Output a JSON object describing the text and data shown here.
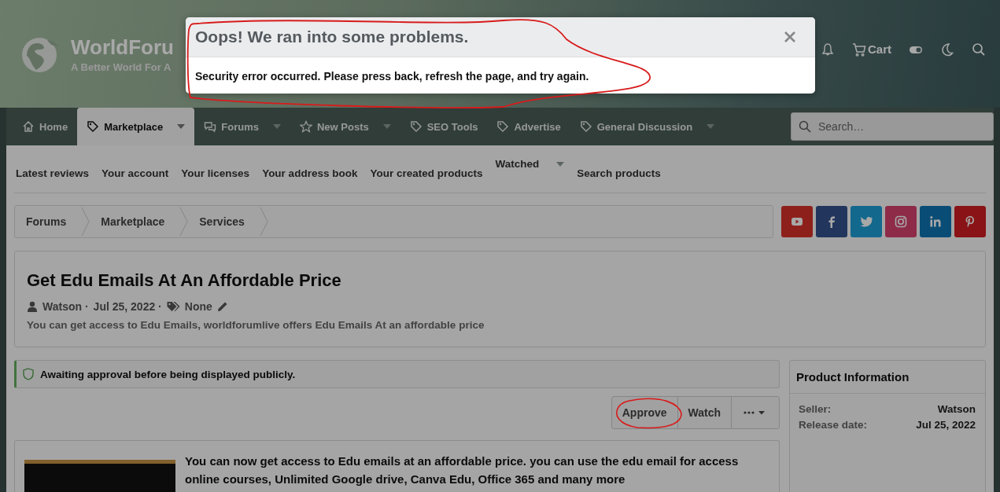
{
  "header": {
    "site_name": "WorldForu",
    "tagline": "A Better World For A",
    "cart_label": "Cart"
  },
  "nav": {
    "tabs": [
      {
        "label": "Home",
        "kind": "home",
        "dropdown": false,
        "selected": false
      },
      {
        "label": "Marketplace",
        "kind": "tag",
        "dropdown": true,
        "selected": true
      },
      {
        "label": "Forums",
        "kind": "forums",
        "dropdown": true,
        "selected": false
      },
      {
        "label": "New Posts",
        "kind": "star",
        "dropdown": true,
        "selected": false
      },
      {
        "label": "SEO Tools",
        "kind": "tag",
        "dropdown": false,
        "selected": false
      },
      {
        "label": "Advertise",
        "kind": "tag",
        "dropdown": false,
        "selected": false
      },
      {
        "label": "General Discussion",
        "kind": "tag",
        "dropdown": true,
        "selected": false
      }
    ],
    "search": {
      "placeholder": "Search…"
    }
  },
  "subnav": [
    {
      "label": "Latest reviews",
      "dropdown": false
    },
    {
      "label": "Your account",
      "dropdown": false
    },
    {
      "label": "Your licenses",
      "dropdown": false
    },
    {
      "label": "Your address book",
      "dropdown": false
    },
    {
      "label": "Your created products",
      "dropdown": false
    },
    {
      "label": "Watched",
      "dropdown": true
    },
    {
      "label": "Search products",
      "dropdown": false
    }
  ],
  "breadcrumb": [
    "Forums",
    "Marketplace",
    "Services"
  ],
  "social": [
    {
      "kind": "youtube"
    },
    {
      "kind": "facebook"
    },
    {
      "kind": "twitter"
    },
    {
      "kind": "instagram"
    },
    {
      "kind": "linkedin"
    },
    {
      "kind": "pinterest"
    }
  ],
  "product": {
    "title": "Get Edu Emails At An Affordable Price",
    "author": "Watson ·",
    "date": "Jul 25, 2022 ·",
    "tags": "None",
    "description": "You can get access to Edu Emails, worldforumlive offers Edu Emails At an affordable price"
  },
  "notice": "Awaiting approval before being displayed publicly.",
  "actions": [
    "Approve",
    "Watch"
  ],
  "body": "You can now get access to Edu emails at an affordable price. you can use the edu email for access online courses, Unlimited Google drive, Canva Edu, Office 365 and many more",
  "sidebar": {
    "title": "Product Information",
    "rows": [
      {
        "label": "Seller:",
        "value": "Watson"
      },
      {
        "label": "Release date:",
        "value": "Jul 25, 2022"
      }
    ]
  },
  "modal": {
    "title": "Oops! We ran into some problems.",
    "message": "Security error occurred. Please press back, refresh the page, and try again."
  }
}
